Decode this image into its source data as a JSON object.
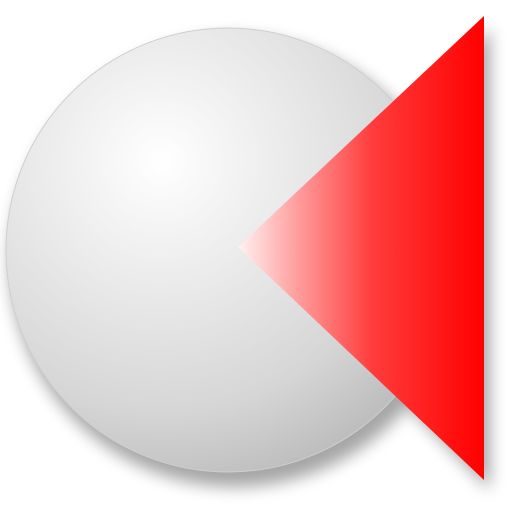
{
  "logo": {
    "icon_name": "gray-sphere-red-triangle-logo-icon",
    "sphere_icon": "gray-sphere-icon",
    "triangle_icon": "red-left-pointing-triangle-icon",
    "colors": {
      "background": "#ffffff",
      "sphere_highlight": "#ffffff",
      "sphere_mid": "#e6e6e6",
      "sphere_shadow": "#bdbdbd",
      "triangle_red": "#ff0000",
      "triangle_light": "#ffe6e6"
    }
  }
}
